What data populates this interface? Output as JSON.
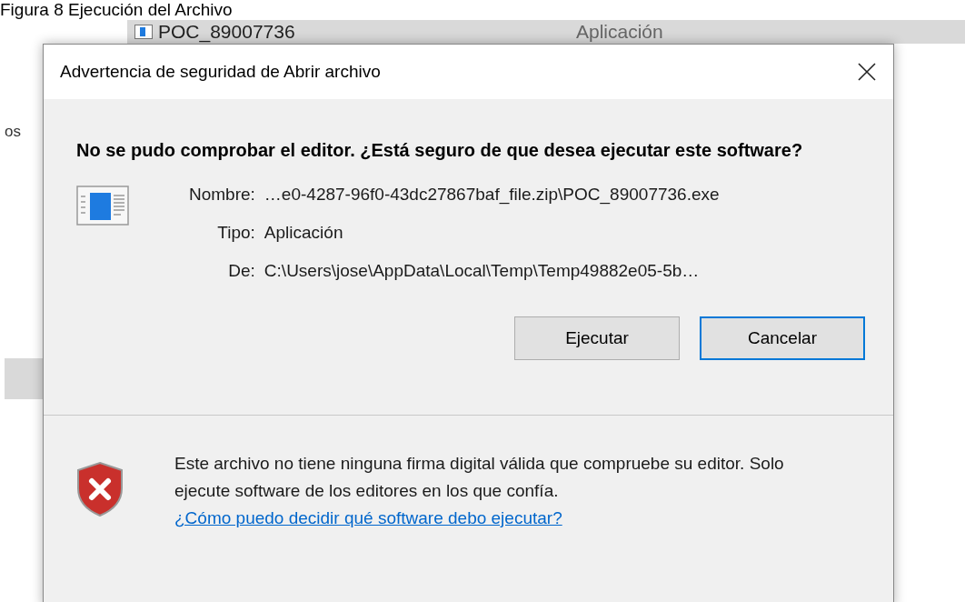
{
  "caption": "Figura 8 Ejecución del Archivo",
  "background": {
    "file_row": {
      "name": "POC_89007736",
      "type": "Aplicación"
    },
    "sidebar_fragment": "os"
  },
  "dialog": {
    "title": "Advertencia de seguridad de Abrir archivo",
    "heading": "No se pudo comprobar el editor. ¿Está seguro de que desea ejecutar este software?",
    "fields": [
      {
        "label": "Nombre:",
        "value": "…e0-4287-96f0-43dc27867baf_file.zip\\POC_89007736.exe"
      },
      {
        "label": "Tipo:",
        "value": "Aplicación"
      },
      {
        "label": "De:",
        "value": "C:\\Users\\jose\\AppData\\Local\\Temp\\Temp49882e05-5b…"
      }
    ],
    "buttons": [
      {
        "label": "Ejecutar",
        "focused": false
      },
      {
        "label": "Cancelar",
        "focused": true
      }
    ],
    "warning": {
      "text": "Este archivo no tiene ninguna firma digital válida que compruebe su editor. Solo ejecute software de los editores en los que confía.",
      "link": "¿Cómo puedo decidir qué software debo ejecutar?"
    }
  }
}
